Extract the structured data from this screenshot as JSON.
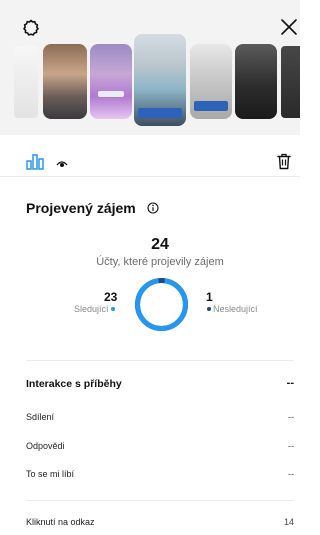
{
  "stories": [
    {
      "name": "story-thumbnail-0"
    },
    {
      "name": "story-thumbnail-1"
    },
    {
      "name": "story-thumbnail-2"
    },
    {
      "name": "story-thumbnail-3",
      "selected": true
    },
    {
      "name": "story-thumbnail-4"
    },
    {
      "name": "story-thumbnail-5"
    },
    {
      "name": "story-thumbnail-6"
    }
  ],
  "interest": {
    "title": "Projevený zájem",
    "total": "24",
    "total_label": "Účty, které projevily zájem",
    "followers_count": "23",
    "followers_label": "Sledující",
    "nonfollowers_count": "1",
    "nonfollowers_label": "Nesledující",
    "followers_fraction": 0.958
  },
  "interactions": {
    "title": "Interakce s příběhy",
    "title_value": "--",
    "rows": [
      {
        "label": "Sdílení",
        "value": "--"
      },
      {
        "label": "Odpovědi",
        "value": "--"
      },
      {
        "label": "To se mi líbí",
        "value": "--"
      }
    ]
  },
  "link_clicks": {
    "label": "Kliknutí na odkaz",
    "value": "14"
  },
  "colors": {
    "accent": "#2597f0",
    "nonfollower": "#1a4a8c"
  },
  "icons": {
    "top_left": "settings-icon",
    "top_right": "close-icon",
    "tool_1": "bar-chart-icon",
    "tool_2": "eye-icon",
    "tool_3": "trash-icon",
    "info": "info-icon"
  }
}
